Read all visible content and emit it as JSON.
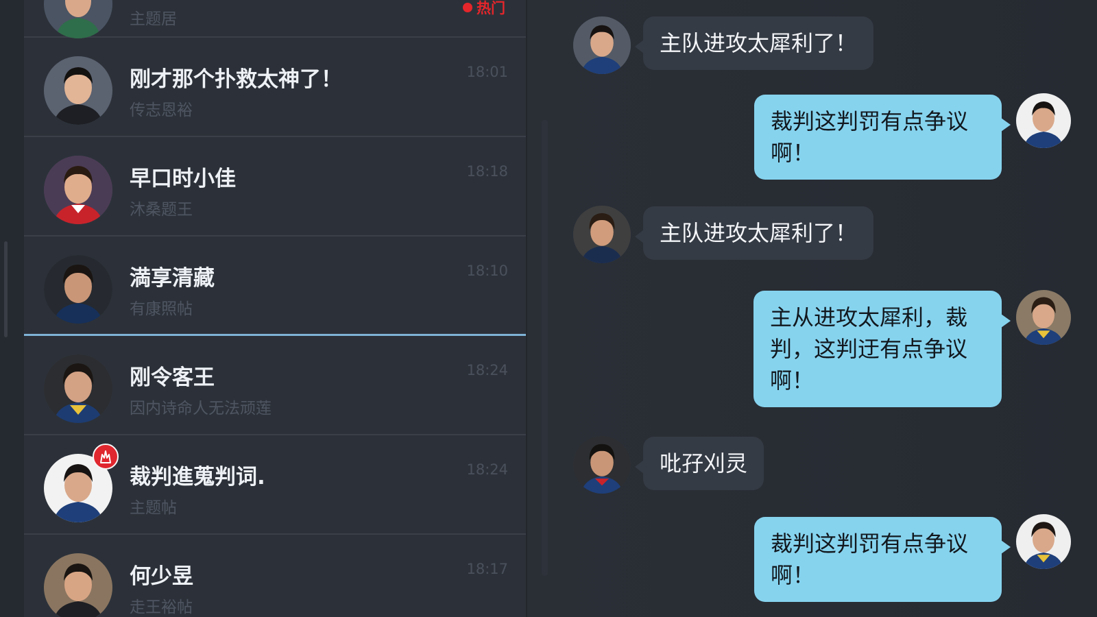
{
  "conversations": [
    {
      "name": "",
      "preview": "主题居",
      "time": "",
      "tag": "热门"
    },
    {
      "name": "刚才那个扑救太神了！",
      "preview": "传志恩裕",
      "time": "18:01"
    },
    {
      "name": "早口时小佳",
      "preview": "沐桑题王",
      "time": "18:18"
    },
    {
      "name": "満享清藏",
      "preview": "有康照帖",
      "time": "18:10"
    },
    {
      "name": "刚令客王",
      "preview": "因内诗命人无法顽莲",
      "time": "18:24"
    },
    {
      "name": "裁判進蒐判词.",
      "preview": "主题帖",
      "time": "18:24"
    },
    {
      "name": "何少昱",
      "preview": "走王裕帖",
      "time": "18:17"
    }
  ],
  "messages": [
    {
      "direction": "in",
      "text": "主队进攻太犀利了！"
    },
    {
      "direction": "out",
      "text": "裁判这判罚有点争议啊！"
    },
    {
      "direction": "in",
      "text": "主队进攻太犀利了！"
    },
    {
      "direction": "out",
      "text": "主从进攻太犀利，裁判，这判迂有点争议啊！"
    },
    {
      "direction": "in",
      "text": "吡孖刈灵"
    },
    {
      "direction": "out",
      "text": "裁判这判罚有点争议啊！"
    }
  ],
  "icons": {
    "hot_badge": "flame-icon",
    "avatar": "user-avatar"
  },
  "colors": {
    "background": "#272b31",
    "list_bg": "#2c3139",
    "incoming_bubble": "#353b44",
    "outgoing_bubble": "#86d3ee",
    "selected_underline": "#7fb3d6",
    "badge": "#e0262e"
  }
}
